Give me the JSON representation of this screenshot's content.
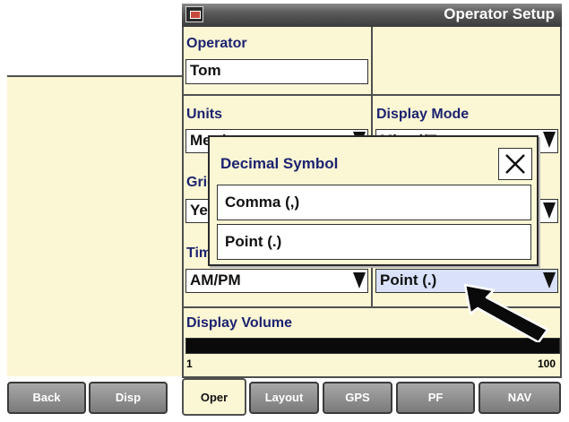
{
  "window": {
    "title": "Operator Setup",
    "icon": "display-icon"
  },
  "operator": {
    "label": "Operator",
    "value": "Tom"
  },
  "units": {
    "label": "Units",
    "value": "Metric"
  },
  "display_mode": {
    "label": "Display Mode",
    "value": "Mixed/Text"
  },
  "grid": {
    "label": "Grid",
    "value": "Yes"
  },
  "time": {
    "label": "Time",
    "value": "AM/PM"
  },
  "decimal": {
    "value": "Point (.)"
  },
  "display_volume": {
    "label": "Display Volume",
    "min": "1",
    "max": "100",
    "level": 1.0
  },
  "modal": {
    "title": "Decimal Symbol",
    "options": [
      "Comma (,)",
      "Point (.)"
    ]
  },
  "tabs": [
    "Back",
    "Disp",
    "Oper",
    "Layout",
    "GPS",
    "PF",
    "NAV"
  ],
  "active_tab": "Oper",
  "colors": {
    "panel": "#fbf6d4",
    "label": "#1c2370",
    "highlight": "#d9e2fa",
    "tab": "#8a8a8a"
  }
}
